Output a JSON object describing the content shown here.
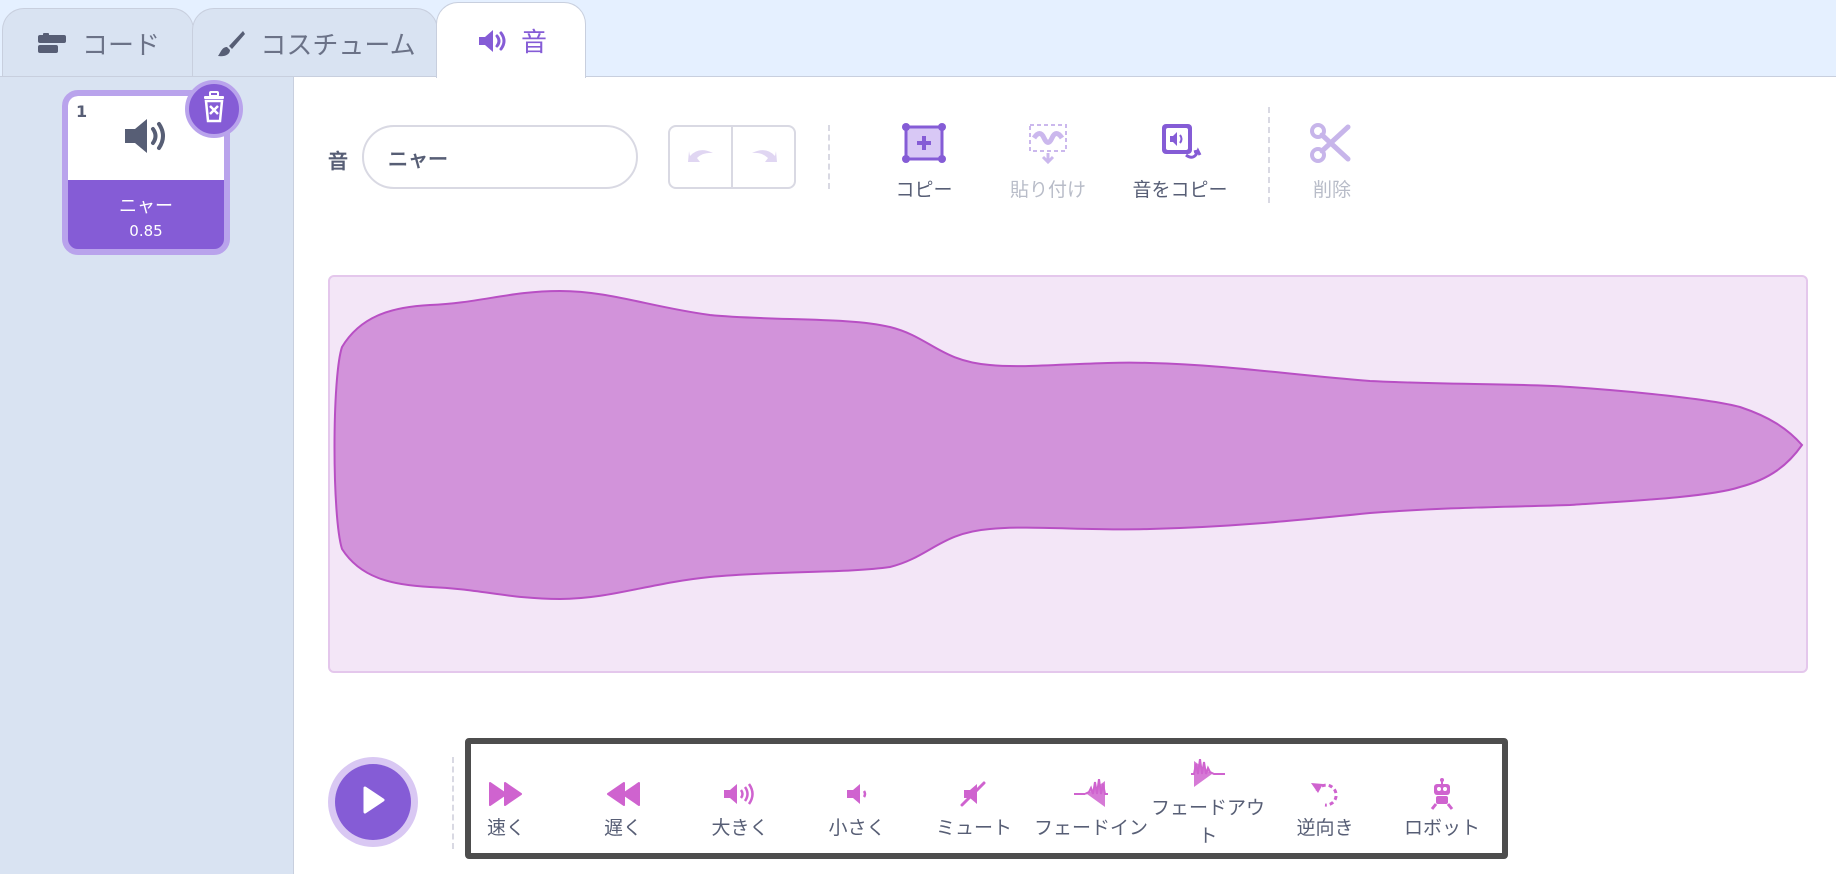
{
  "tabs": [
    {
      "label": "コード",
      "icon": "code-blocks-icon"
    },
    {
      "label": "コスチューム",
      "icon": "brush-icon"
    },
    {
      "label": "音",
      "icon": "speaker-icon"
    }
  ],
  "sidebar": {
    "sound_item": {
      "number": "1",
      "name": "ニャー",
      "duration": "0.85",
      "icon": "speaker-icon"
    }
  },
  "editor": {
    "name_label": "音",
    "name_value": "ニャー",
    "tools": [
      {
        "label": "コピー",
        "icon": "copy-icon"
      },
      {
        "label": "貼り付け",
        "icon": "paste-icon"
      },
      {
        "label": "音をコピー",
        "icon": "copy-to-new-icon"
      },
      {
        "label": "削除",
        "icon": "scissors-icon"
      }
    ]
  },
  "effects": [
    {
      "label": "速く",
      "icon": "faster-icon"
    },
    {
      "label": "遅く",
      "icon": "slower-icon"
    },
    {
      "label": "大きく",
      "icon": "louder-icon"
    },
    {
      "label": "小さく",
      "icon": "softer-icon"
    },
    {
      "label": "ミュート",
      "icon": "mute-icon"
    },
    {
      "label": "フェードイン",
      "icon": "fade-in-icon"
    },
    {
      "label": "フェードアウト",
      "icon": "fade-out-icon"
    },
    {
      "label": "逆向き",
      "icon": "reverse-icon"
    },
    {
      "label": "ロボット",
      "icon": "robot-icon"
    }
  ],
  "colors": {
    "accent": "#855cd6",
    "wave_fill": "#d293da",
    "wave_stroke": "#b84fc4",
    "wave_bg": "#f3e6f7"
  }
}
